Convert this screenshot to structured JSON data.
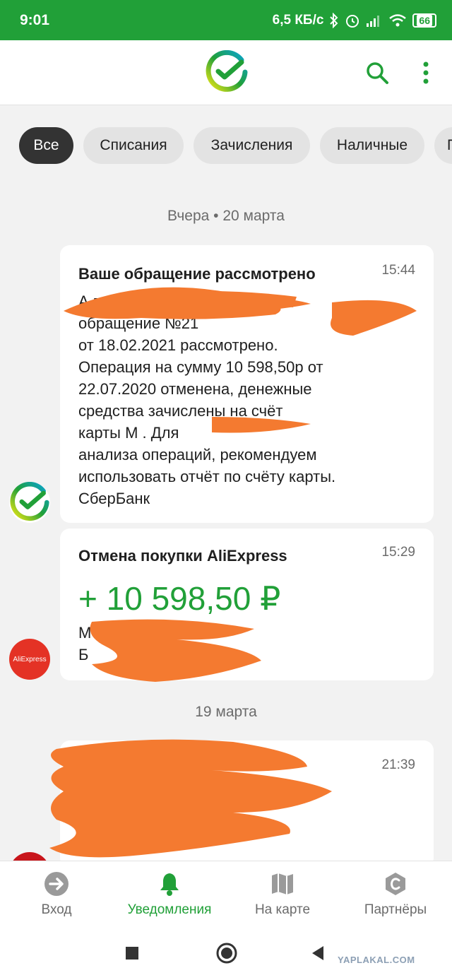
{
  "status_bar": {
    "time": "9:01",
    "network_speed": "6,5 КБ/с",
    "battery": "66"
  },
  "app_bar": {
    "logo": "sberbank-logo",
    "search_icon": "search-icon",
    "more_icon": "more-vert-icon"
  },
  "filters": [
    {
      "label": "Все",
      "active": true
    },
    {
      "label": "Списания",
      "active": false
    },
    {
      "label": "Зачисления",
      "active": false
    },
    {
      "label": "Наличные",
      "active": false
    },
    {
      "label": "П",
      "active": false
    }
  ],
  "feed": {
    "date_1": "Вчера • 20 марта",
    "card_1": {
      "title": "Ваше обращение рассмотрено",
      "time": "15:44",
      "body": "А                        ваше\nобращение №21        \nот 18.02.2021 рассмотрено.\nОперация на сумму 10 598,50р от\n22.07.2020 отменена, денежные\nсредства зачислены на счёт\nкарты М                          . Для\nанализа операций, рекомендуем\nиспользовать отчёт по счёту карты.\nСберБанк"
    },
    "card_2": {
      "title": "Отмена покупки AliExpress",
      "time": "15:29",
      "amount": "+ 10 598,50 ₽",
      "body": "М\nБ"
    },
    "date_2": "19 марта",
    "card_3": {
      "time": "21:39"
    },
    "avatar_aliexpress": "AliExpress"
  },
  "bottom_nav": [
    {
      "label": "Вход",
      "icon": "login-arrow-icon",
      "active": false
    },
    {
      "label": "Уведомления",
      "icon": "bell-icon",
      "active": true
    },
    {
      "label": "На карте",
      "icon": "map-icon",
      "active": false
    },
    {
      "label": "Партнёры",
      "icon": "partners-icon",
      "active": false
    }
  ],
  "watermark": "YAPLAKAL.COM",
  "colors": {
    "brand_green": "#21a038",
    "chip_active": "#333333",
    "chip_inactive": "#e3e3e3",
    "redaction": "#f47a30"
  }
}
